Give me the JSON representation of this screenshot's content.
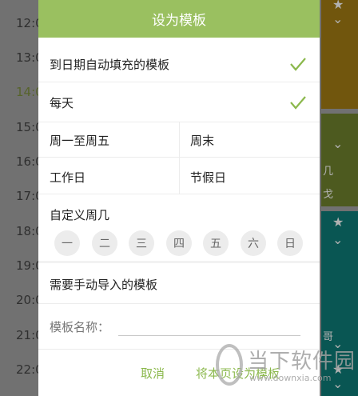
{
  "background": {
    "times": [
      "12:0",
      "13:0",
      "14:0",
      "15:0",
      "16:0",
      "17:0",
      "18:0",
      "19:0",
      "20:0",
      "21:0",
      "22:0"
    ],
    "side_glyphs": [
      "★",
      "⌄",
      "⌄",
      "⌄",
      "★",
      "⌄",
      "★",
      "⌄",
      "几",
      "戈",
      "哥"
    ]
  },
  "dialog": {
    "title": "设为模板",
    "auto_fill_label": "到日期自动填充的模板",
    "every_day_label": "每天",
    "weekdays_label": "周一至周五",
    "weekend_label": "周末",
    "workday_label": "工作日",
    "holiday_label": "节假日",
    "custom_weekday_label": "自定义周几",
    "weekdays": [
      "一",
      "二",
      "三",
      "四",
      "五",
      "六",
      "日"
    ],
    "manual_import_label": "需要手动导入的模板",
    "template_name_label": "模板名称：",
    "template_name_value": "",
    "cancel_label": "取消",
    "confirm_label": "将本页设为模板"
  },
  "watermark": {
    "text": "当下软件园",
    "url": "www.downxia.com"
  },
  "colors": {
    "accent": "#9ac060",
    "button_text": "#8bb84c"
  }
}
